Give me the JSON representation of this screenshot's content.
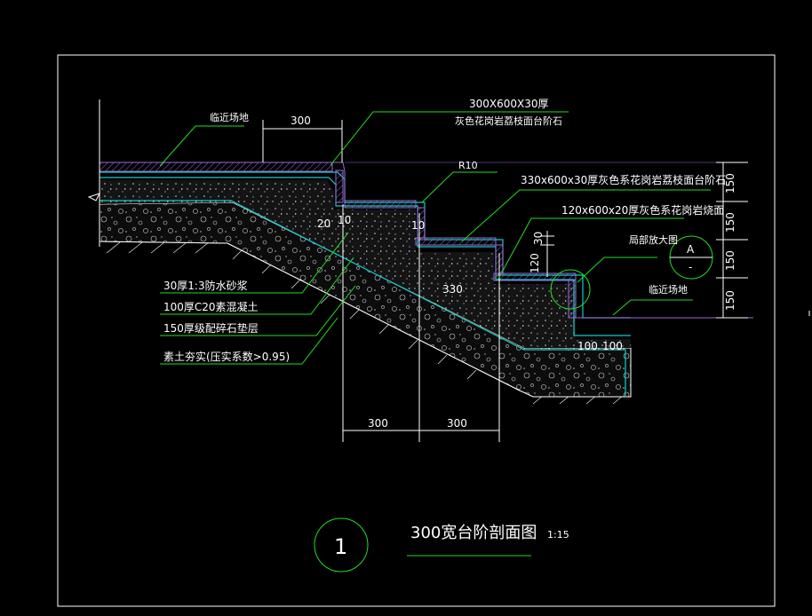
{
  "title": {
    "number": "1",
    "text": "300宽台阶剖面图",
    "scale": "1:15"
  },
  "labels": {
    "site_left": "临近场地",
    "site_right": "临近场地",
    "top_spec_line1": "300X600X30厚",
    "top_spec_line2": "灰色花岗岩荔枝面台阶石",
    "radius": "R10",
    "step_stone": "330x600x30厚灰色系花岗岩荔枝面台阶石",
    "riser_stone": "120x600x20厚灰色系花岗岩烧面",
    "detail_ref": "局部放大图",
    "detail_letter": "A",
    "detail_dash": "-"
  },
  "layers": [
    "30厚1:3防水砂浆",
    "100厚C20素混凝土",
    "150厚级配碎石垫层",
    "素土夯实(压实系数>0.95)"
  ],
  "dimensions": {
    "top_300": "300",
    "d20": "20",
    "d10a": "10",
    "d10b": "10",
    "d330": "330",
    "d30": "30",
    "d120": "120",
    "d100a": "100",
    "d100b": "100",
    "bottom_300a": "300",
    "bottom_300b": "300",
    "right_150": [
      "150",
      "150",
      "150",
      "150"
    ]
  },
  "colors": {
    "frame": "#ffffff",
    "leader": "#22dd22",
    "finish": "#11cccc",
    "surface": "#9b6bd6",
    "concrete": "#1a1a1a"
  }
}
